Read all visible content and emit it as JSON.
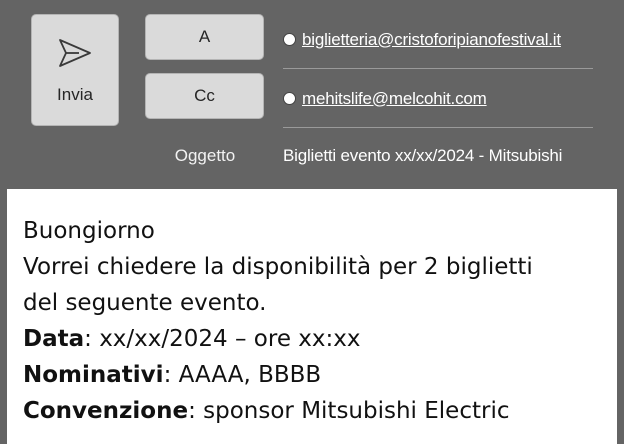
{
  "header": {
    "send_label": "Invia",
    "to_label": "A",
    "cc_label": "Cc",
    "to_address": "biglietteria@cristoforipianofestival.it",
    "cc_address": "mehitslife@melcohit.com",
    "subject_label": "Oggetto",
    "subject_value": "Biglietti evento xx/xx/2024 - Mitsubishi"
  },
  "body": {
    "greeting": "Buongiorno",
    "line1": "Vorrei chiedere la disponibilità per 2 biglietti",
    "line2": "del seguente evento.",
    "date_label": "Data",
    "date_value": ": xx/xx/2024 – ore xx:xx",
    "names_label": "Nominativi",
    "names_value": ": AAAA, BBBB",
    "agreement_label": "Convenzione",
    "agreement_value": ": sponsor Mitsubishi Electric"
  },
  "icons": {
    "send": "paper-plane-icon"
  },
  "colors": {
    "header_bg": "#646464",
    "button_bg": "#dadada",
    "body_bg": "#ffffff"
  }
}
